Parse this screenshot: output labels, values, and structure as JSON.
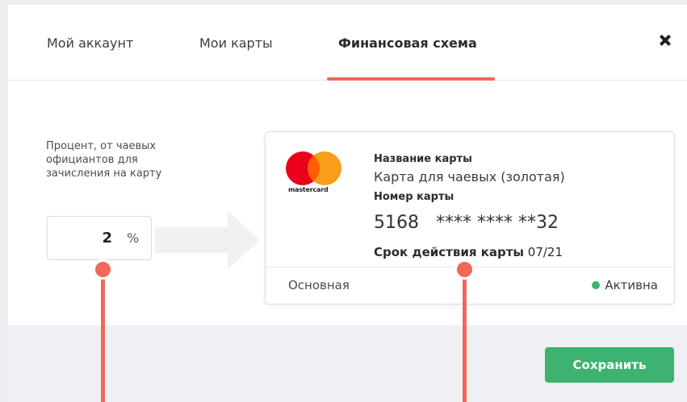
{
  "tabs": [
    {
      "label": "Мой аккаунт",
      "active": false
    },
    {
      "label": "Мои карты",
      "active": false
    },
    {
      "label": "Финансовая схема",
      "active": true
    }
  ],
  "close_icon": "close-icon",
  "percent": {
    "label": "Процент, от чаевых официантов для зачисления на карту",
    "value": "2",
    "unit": "%"
  },
  "card": {
    "brand": "mastercard",
    "name_label": "Название карты",
    "name_value": "Карта для чаевых (золотая)",
    "number_label": "Номер карты",
    "number_value": "5168   **** **** **32",
    "expiry_label": "Срок действия карты",
    "expiry_value": "07/21",
    "type": "Основная",
    "status": "Активна",
    "status_color": "#3db36f"
  },
  "footer": {
    "save_label": "Сохранить"
  },
  "colors": {
    "accent": "#f0685a",
    "primary_button": "#3db36f"
  }
}
